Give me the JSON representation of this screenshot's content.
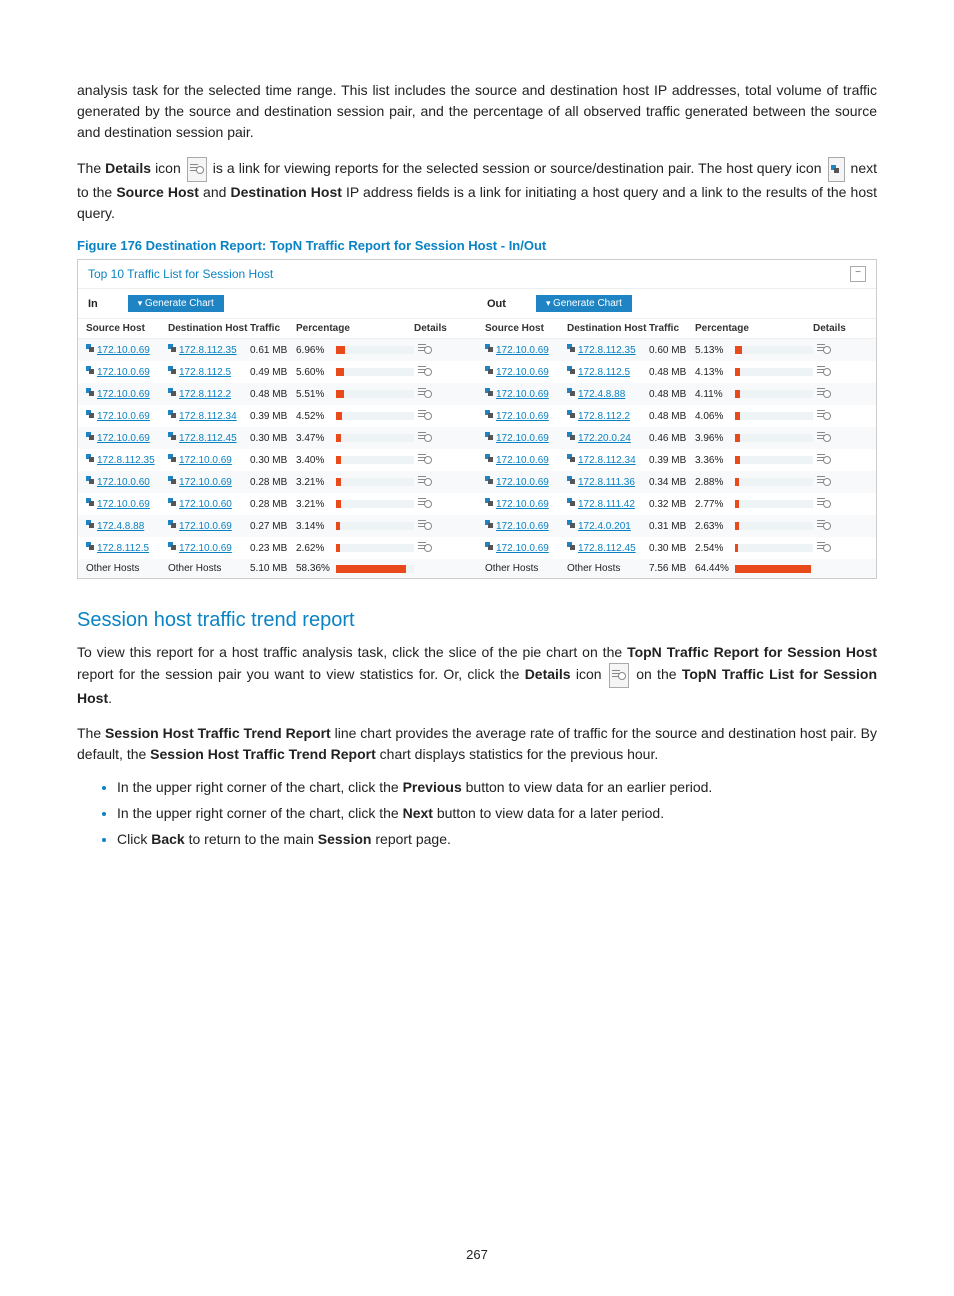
{
  "page_number": "267",
  "intro_para1": "analysis task for the selected time range. This list includes the source and destination host IP addresses, total volume of traffic generated by the source and destination session pair, and the percentage of all observed traffic generated between the source and destination session pair.",
  "intro_para2_a": "The ",
  "intro_para2_b": "Details",
  "intro_para2_c": " icon ",
  "intro_para2_d": " is a link for viewing reports for the selected session or source/destination pair. The host query icon ",
  "intro_para2_e": " next to the ",
  "intro_para2_f": "Source Host",
  "intro_para2_g": " and ",
  "intro_para2_h": "Destination Host",
  "intro_para2_i": " IP address fields is a link for initiating a host query and a link to the results of the host query.",
  "figure_caption": "Figure 176 Destination Report: TopN Traffic Report for Session Host - In/Out",
  "panel_title": "Top 10 Traffic List for Session Host",
  "dir_in_label": "In",
  "dir_out_label": "Out",
  "generate_chart_label": "Generate Chart",
  "columns": {
    "src": "Source Host",
    "dst": "Destination Host",
    "trf": "Traffic",
    "pct": "Percentage",
    "det": "Details"
  },
  "in_rows": [
    {
      "src": "172.10.0.69",
      "dst": "172.8.112.35",
      "trf": "0.61 MB",
      "pct": "6.96%",
      "w": 12
    },
    {
      "src": "172.10.0.69",
      "dst": "172.8.112.5",
      "trf": "0.49 MB",
      "pct": "5.60%",
      "w": 10
    },
    {
      "src": "172.10.0.69",
      "dst": "172.8.112.2",
      "trf": "0.48 MB",
      "pct": "5.51%",
      "w": 10
    },
    {
      "src": "172.10.0.69",
      "dst": "172.8.112.34",
      "trf": "0.39 MB",
      "pct": "4.52%",
      "w": 8
    },
    {
      "src": "172.10.0.69",
      "dst": "172.8.112.45",
      "trf": "0.30 MB",
      "pct": "3.47%",
      "w": 6
    },
    {
      "src": "172.8.112.35",
      "dst": "172.10.0.69",
      "trf": "0.30 MB",
      "pct": "3.40%",
      "w": 6
    },
    {
      "src": "172.10.0.60",
      "dst": "172.10.0.69",
      "trf": "0.28 MB",
      "pct": "3.21%",
      "w": 6
    },
    {
      "src": "172.10.0.69",
      "dst": "172.10.0.60",
      "trf": "0.28 MB",
      "pct": "3.21%",
      "w": 6
    },
    {
      "src": "172.4.8.88",
      "dst": "172.10.0.69",
      "trf": "0.27 MB",
      "pct": "3.14%",
      "w": 5
    },
    {
      "src": "172.8.112.5",
      "dst": "172.10.0.69",
      "trf": "0.23 MB",
      "pct": "2.62%",
      "w": 5
    },
    {
      "src": "Other Hosts",
      "dst": "Other Hosts",
      "trf": "5.10 MB",
      "pct": "58.36%",
      "w": 90,
      "plain": true
    }
  ],
  "out_rows": [
    {
      "src": "172.10.0.69",
      "dst": "172.8.112.35",
      "trf": "0.60 MB",
      "pct": "5.13%",
      "w": 9
    },
    {
      "src": "172.10.0.69",
      "dst": "172.8.112.5",
      "trf": "0.48 MB",
      "pct": "4.13%",
      "w": 7
    },
    {
      "src": "172.10.0.69",
      "dst": "172.4.8.88",
      "trf": "0.48 MB",
      "pct": "4.11%",
      "w": 7
    },
    {
      "src": "172.10.0.69",
      "dst": "172.8.112.2",
      "trf": "0.48 MB",
      "pct": "4.06%",
      "w": 7
    },
    {
      "src": "172.10.0.69",
      "dst": "172.20.0.24",
      "trf": "0.46 MB",
      "pct": "3.96%",
      "w": 7
    },
    {
      "src": "172.10.0.69",
      "dst": "172.8.112.34",
      "trf": "0.39 MB",
      "pct": "3.36%",
      "w": 6
    },
    {
      "src": "172.10.0.69",
      "dst": "172.8.111.36",
      "trf": "0.34 MB",
      "pct": "2.88%",
      "w": 5
    },
    {
      "src": "172.10.0.69",
      "dst": "172.8.111.42",
      "trf": "0.32 MB",
      "pct": "2.77%",
      "w": 5
    },
    {
      "src": "172.10.0.69",
      "dst": "172.4.0.201",
      "trf": "0.31 MB",
      "pct": "2.63%",
      "w": 5
    },
    {
      "src": "172.10.0.69",
      "dst": "172.8.112.45",
      "trf": "0.30 MB",
      "pct": "2.54%",
      "w": 4
    },
    {
      "src": "Other Hosts",
      "dst": "Other Hosts",
      "trf": "7.56 MB",
      "pct": "64.44%",
      "w": 98,
      "plain": true
    }
  ],
  "section_heading": "Session host traffic trend report",
  "sec_p1_a": "To view this report for a host traffic analysis task, click the slice of the pie chart on the ",
  "sec_p1_b": "TopN Traffic Report for Session Host",
  "sec_p1_c": " report for the session pair you want to view statistics for. Or, click the ",
  "sec_p1_d": "Details",
  "sec_p1_e": " icon ",
  "sec_p1_f": " on the ",
  "sec_p1_g": "TopN Traffic List for Session Host",
  "sec_p1_h": ".",
  "sec_p2_a": "The ",
  "sec_p2_b": "Session Host Traffic Trend Report",
  "sec_p2_c": " line chart provides the average rate of traffic for the source and destination host pair. By default, the ",
  "sec_p2_d": "Session Host Traffic Trend Report",
  "sec_p2_e": " chart displays statistics for the previous hour.",
  "bullet1_a": "In the upper right corner of the chart, click the ",
  "bullet1_b": "Previous",
  "bullet1_c": " button to view data for an earlier period.",
  "bullet2_a": "In the upper right corner of the chart, click the ",
  "bullet2_b": "Next",
  "bullet2_c": " button to view data for a later period.",
  "bullet3_a": "Click ",
  "bullet3_b": "Back",
  "bullet3_c": " to return to the main ",
  "bullet3_d": "Session",
  "bullet3_e": " report page."
}
